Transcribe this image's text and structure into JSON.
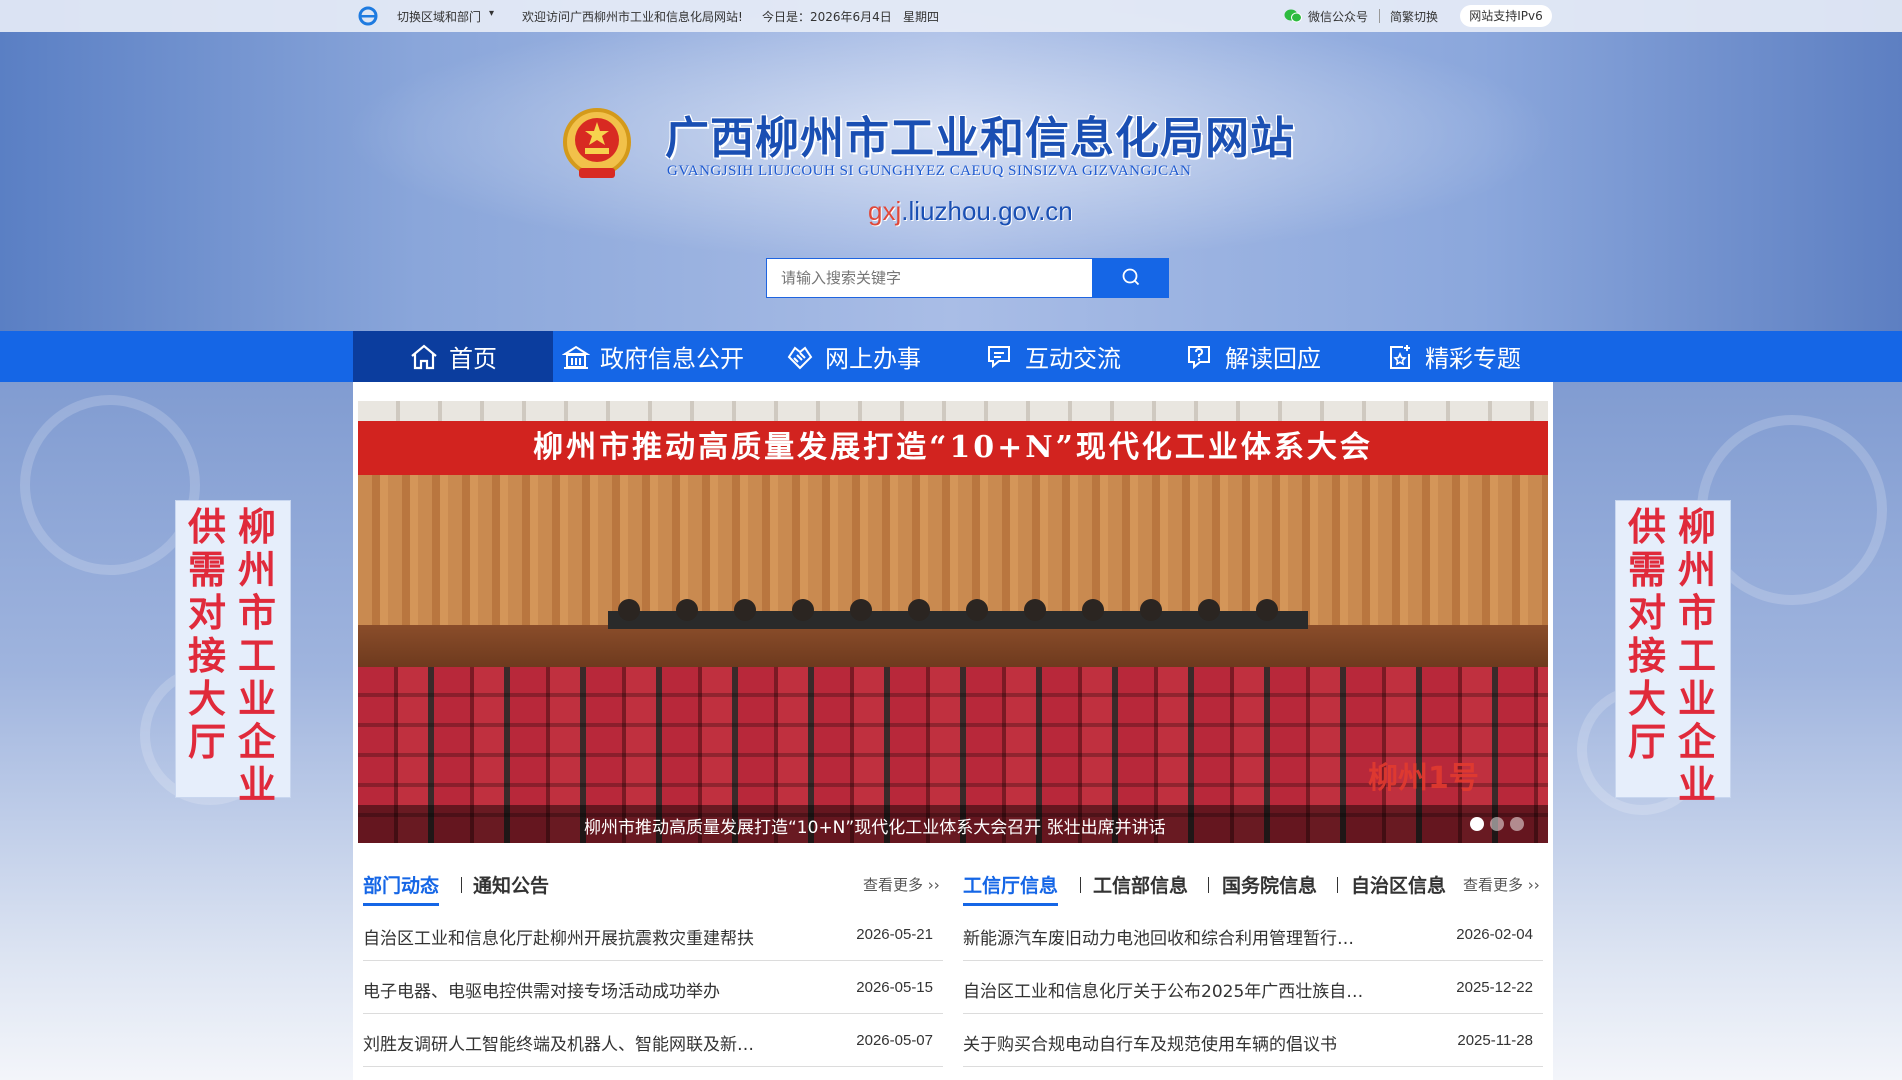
{
  "topbar": {
    "region_label": "切换区域和部门",
    "welcome": "欢迎访问广西柳州市工业和信息化局网站!",
    "date_label": "今日是：2026年6月4日",
    "weekday": "星期四",
    "wechat": "微信公众号",
    "simplified": "简繁切换",
    "ipv6": "网站支持IPv6"
  },
  "header": {
    "title": "广西柳州市工业和信息化局网站",
    "subtitle": "GVANGJSIH LIUJCOUH SI GUNGHYEZ CAEUQ SINSIZVA GIZVANGJCAN",
    "domain_prefix": "gxj",
    "domain_suffix": ".liuzhou.gov.cn"
  },
  "search": {
    "placeholder": "请输入搜索关键字"
  },
  "nav": {
    "items": [
      {
        "label": "首页",
        "icon": "home-icon"
      },
      {
        "label": "政府信息公开",
        "icon": "building-icon"
      },
      {
        "label": "网上办事",
        "icon": "handshake-icon"
      },
      {
        "label": "互动交流",
        "icon": "chat-icon"
      },
      {
        "label": "解读回应",
        "icon": "question-icon"
      },
      {
        "label": "精彩专题",
        "icon": "star-doc-icon"
      }
    ]
  },
  "banner": {
    "headline": "柳州市推动高质量发展打造“10+N”现代化工业体系大会",
    "caption": "柳州市推动高质量发展打造“10+N”现代化工业体系大会召开 张壮出席并讲话",
    "watermark": "柳州1号"
  },
  "left_column": {
    "tabs": [
      "部门动态",
      "通知公告"
    ],
    "more": "查看更多 ››",
    "news": [
      {
        "title": "自治区工业和信息化厅赴柳州开展抗震救灾重建帮扶",
        "date": "2026-05-21"
      },
      {
        "title": "电子电器、电驱电控供需对接专场活动成功举办",
        "date": "2026-05-15"
      },
      {
        "title": "刘胜友调研人工智能终端及机器人、智能网联及新…",
        "date": "2026-05-07"
      }
    ]
  },
  "right_column": {
    "tabs": [
      "工信厅信息",
      "工信部信息",
      "国务院信息",
      "自治区信息"
    ],
    "more": "查看更多 ››",
    "news": [
      {
        "title": "新能源汽车废旧动力电池回收和综合利用管理暂行…",
        "date": "2026-02-04"
      },
      {
        "title": "自治区工业和信息化厅关于公布2025年广西壮族自…",
        "date": "2025-12-22"
      },
      {
        "title": "关于购买合规电动自行车及规范使用车辆的倡议书",
        "date": "2025-11-28"
      }
    ]
  },
  "side_banner": {
    "col1": [
      "供",
      "需",
      "对",
      "接",
      "大",
      "厅"
    ],
    "col2": [
      "柳",
      "州",
      "市",
      "工",
      "业",
      "企",
      "业"
    ]
  },
  "colors": {
    "brand_blue": "#1566e6",
    "nav_active": "#0b3d9e",
    "accent_red": "#e02a3b"
  }
}
